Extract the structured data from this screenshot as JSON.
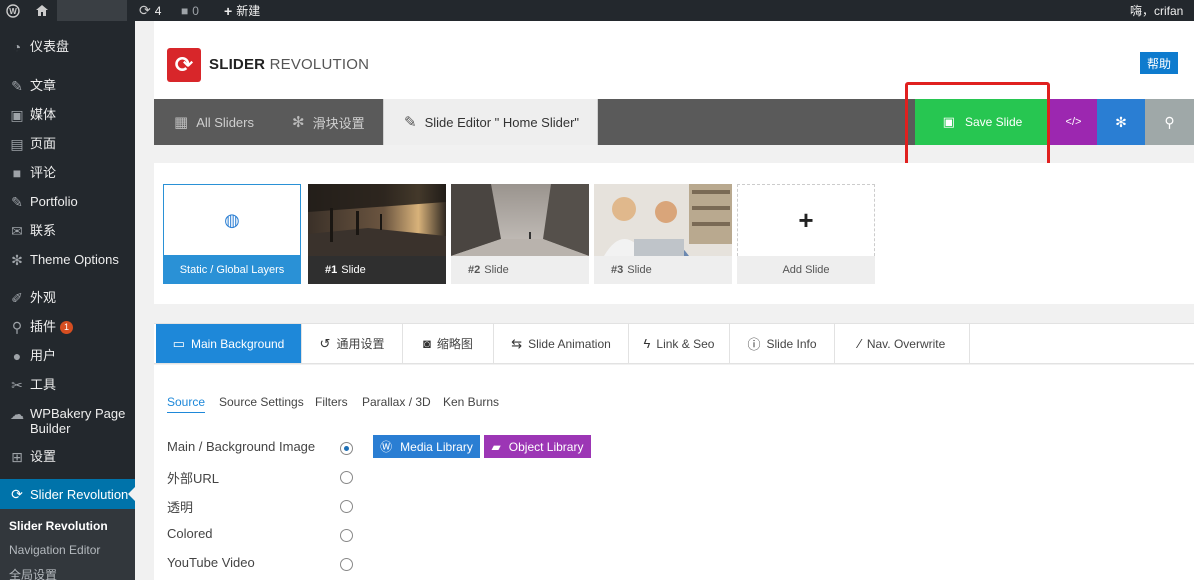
{
  "admin_bar": {
    "updates_count": "4",
    "comments_count": "0",
    "new_label": "新建",
    "greeting": "嗨，crifan"
  },
  "sidebar": {
    "items": [
      {
        "label": "仪表盘",
        "icon": "dashboard-icon"
      },
      {
        "label": "文章",
        "icon": "pin-icon"
      },
      {
        "label": "媒体",
        "icon": "media-icon"
      },
      {
        "label": "页面",
        "icon": "page-icon"
      },
      {
        "label": "评论",
        "icon": "comment-icon"
      },
      {
        "label": "Portfolio",
        "icon": "pin-icon"
      },
      {
        "label": "联系",
        "icon": "mail-icon"
      },
      {
        "label": "Theme Options",
        "icon": "gear-icon"
      },
      {
        "label": "外观",
        "icon": "brush-icon"
      },
      {
        "label": "插件",
        "icon": "plugin-icon",
        "badge": "1"
      },
      {
        "label": "用户",
        "icon": "user-icon"
      },
      {
        "label": "工具",
        "icon": "wrench-icon"
      },
      {
        "label": "WPBakery Page Builder",
        "icon": "cloud-icon"
      },
      {
        "label": "设置",
        "icon": "settings-icon"
      },
      {
        "label": "Slider Revolution",
        "icon": "refresh-icon"
      }
    ],
    "submenu": [
      "Slider Revolution",
      "Navigation Editor",
      "全局设置"
    ]
  },
  "header": {
    "logo_bold": "SLIDER",
    "logo_light": " REVOLUTION",
    "help_label": "帮助"
  },
  "toolbar": {
    "tabs": [
      "All Sliders",
      "滑块设置",
      "Slide Editor \" Home Slider\""
    ],
    "save_label": "Save Slide",
    "code_label": "</>"
  },
  "slides": {
    "static_label": "Static / Global Layers",
    "items": [
      {
        "num": "#1",
        "label": "Slide"
      },
      {
        "num": "#2",
        "label": "Slide"
      },
      {
        "num": "#3",
        "label": "Slide"
      }
    ],
    "add_label": "Add Slide"
  },
  "editor_tabs": [
    "Main Background",
    "通用设置",
    "缩略图",
    "Slide Animation",
    "Link & Seo",
    "Slide Info",
    "Nav. Overwrite"
  ],
  "sub_tabs": [
    "Source",
    "Source Settings",
    "Filters",
    "Parallax / 3D",
    "Ken Burns"
  ],
  "source_options": [
    "Main / Background Image",
    "外部URL",
    "透明",
    "Colored",
    "YouTube Video"
  ],
  "buttons": {
    "media_library": "Media Library",
    "object_library": "Object Library"
  },
  "colors": {
    "save_green": "#27c651",
    "accent_blue": "#1e88d9",
    "purple": "#9c27b0",
    "highlight_red": "#e0201f"
  }
}
